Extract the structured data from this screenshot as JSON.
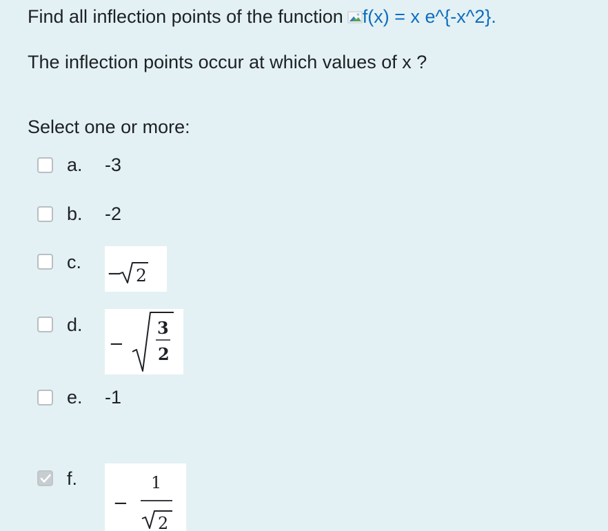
{
  "question": {
    "line1_text": "Find all inflection points of the function",
    "image_alt_text": "f(x) = x e^{-x^2}.",
    "line2_text": "The inflection points occur at which values of x ?"
  },
  "prompt": "Select one or more:",
  "options": [
    {
      "letter": "a.",
      "value": "-3",
      "checked": false
    },
    {
      "letter": "b.",
      "value": "-2",
      "checked": false
    },
    {
      "letter": "c.",
      "value": "-√2",
      "checked": false
    },
    {
      "letter": "d.",
      "value": "-√(3/2)",
      "checked": false
    },
    {
      "letter": "e.",
      "value": "-1",
      "checked": false
    },
    {
      "letter": "f.",
      "value": "-1/√2",
      "checked": true
    }
  ],
  "math_text": {
    "minus": "−",
    "two": "2",
    "three": "3",
    "one": "1"
  },
  "colors": {
    "background": "#e3f1f4",
    "text": "#1d2125",
    "link_blue": "#0f6cbf"
  },
  "icons": {
    "broken_image": "broken-image-icon",
    "check": "checkmark-icon"
  }
}
